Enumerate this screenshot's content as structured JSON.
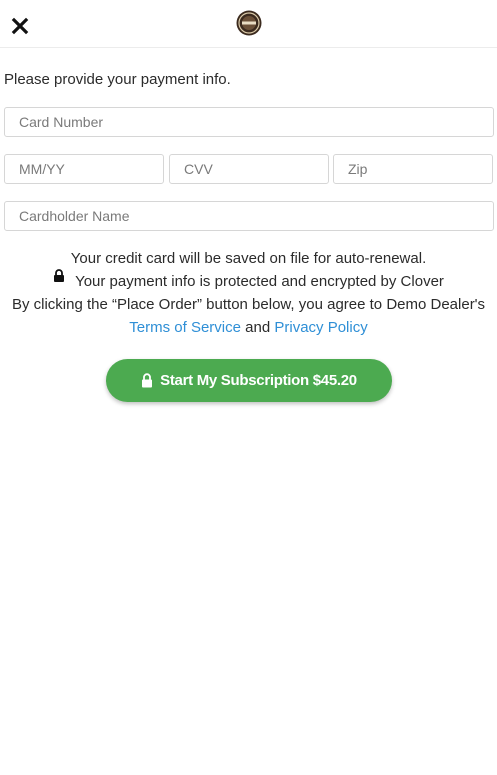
{
  "header": {
    "close_icon": "close-x-icon",
    "logo_icon": "merchant-logo-badge"
  },
  "form": {
    "intro": "Please provide your payment info.",
    "card_number_placeholder": "Card Number",
    "expiry_placeholder": "MM/YY",
    "cvv_placeholder": "CVV",
    "zip_placeholder": "Zip",
    "cardholder_placeholder": "Cardholder Name"
  },
  "notes": {
    "autorenew": "Your credit card will be saved on file for auto-renewal.",
    "security": "Your payment info is protected and encrypted by Clover",
    "agree_prefix": "By clicking the “Place Order” button below, you agree to Demo Dealer's",
    "terms_link": "Terms of Service",
    "and": "and",
    "privacy_link": "Privacy Policy"
  },
  "cta": {
    "label": "Start My Subscription $45.20"
  },
  "colors": {
    "accent_green": "#4caa50",
    "link_blue": "#2f8fd6"
  }
}
